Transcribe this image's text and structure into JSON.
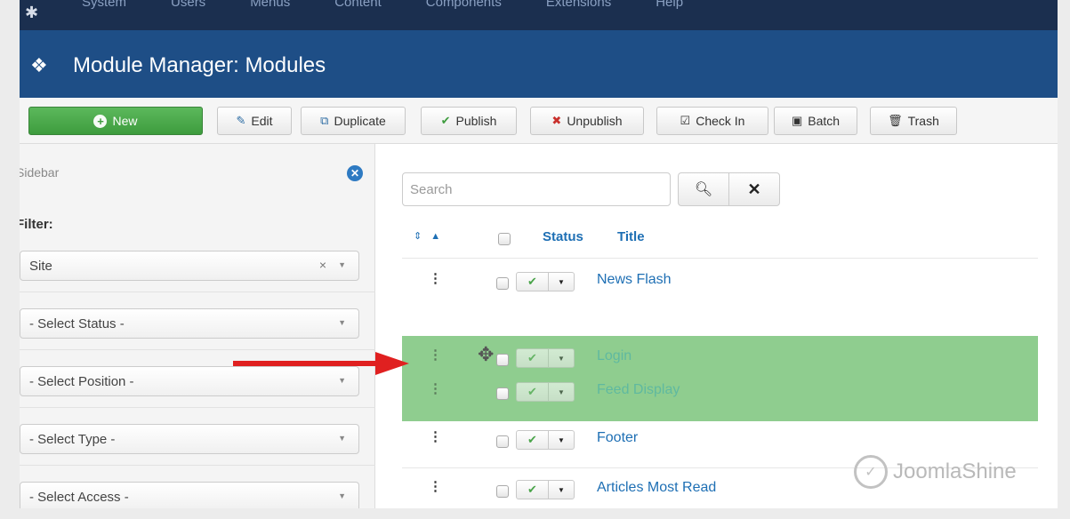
{
  "topbar": {
    "menus": [
      "System",
      "Users",
      "Menus",
      "Content",
      "Components",
      "Extensions",
      "Help"
    ]
  },
  "header": {
    "title": "Module Manager: Modules"
  },
  "toolbar": {
    "new_label": "New",
    "edit_label": "Edit",
    "duplicate_label": "Duplicate",
    "publish_label": "Publish",
    "unpublish_label": "Unpublish",
    "checkin_label": "Check In",
    "batch_label": "Batch",
    "trash_label": "Trash"
  },
  "sidebar": {
    "label": "Sidebar",
    "filter_label": "Filter:",
    "selects": {
      "site": "Site",
      "status": "- Select Status -",
      "position": "- Select Position -",
      "type": "- Select Type -",
      "access": "- Select Access -"
    }
  },
  "search": {
    "placeholder": "Search"
  },
  "table": {
    "headers": {
      "status": "Status",
      "title": "Title"
    },
    "rows": [
      {
        "title": "News Flash"
      },
      {
        "title": "Login"
      },
      {
        "title": "Feed Display"
      },
      {
        "title": "Footer"
      },
      {
        "title": "Articles Most Read"
      }
    ]
  },
  "watermark": {
    "text": "JoomlaShine"
  },
  "colors": {
    "header_bg": "#1e4e86",
    "topbar_bg": "#1b2f4f",
    "new_button": "#4cae4c",
    "link": "#1e6fb4",
    "drag_highlight": "#8fcd8f",
    "arrow": "#e02020"
  },
  "icons": {
    "logo": "joomla-logo-icon",
    "header": "cube-icon",
    "new": "plus-circle-icon",
    "edit": "pencil-square-icon",
    "duplicate": "copy-icon",
    "publish": "check-icon",
    "unpublish": "x-circle-icon",
    "checkin": "check-square-icon",
    "batch": "square-dot-icon",
    "trash": "trash-icon",
    "search": "search-icon",
    "clear": "close-icon",
    "move": "move-cursor-icon"
  }
}
